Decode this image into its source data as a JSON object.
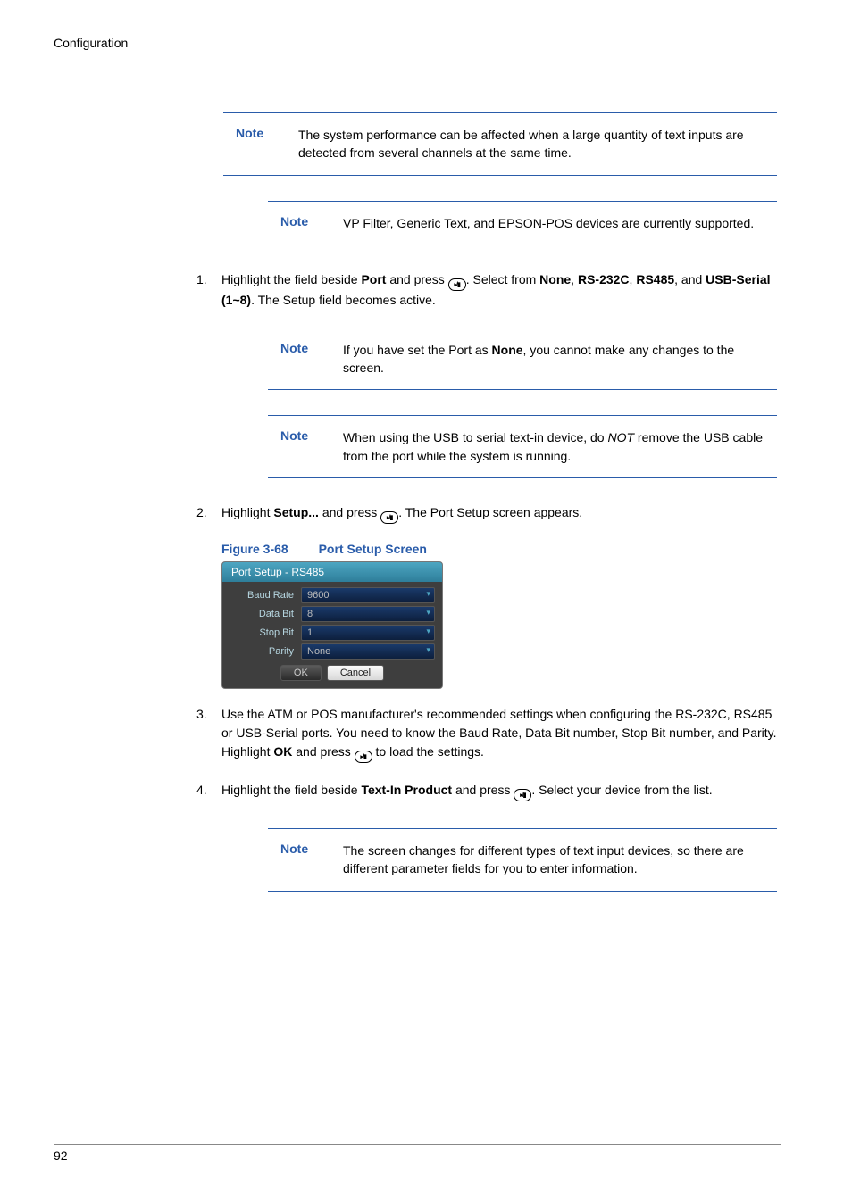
{
  "header": "Configuration",
  "note1": {
    "label": "Note",
    "text": "The system performance can be affected when a large quantity of text inputs are detected from several channels at the same time."
  },
  "note2": {
    "label": "Note",
    "text": "VP Filter, Generic Text, and EPSON-POS devices are currently supported."
  },
  "step1": {
    "num": "1.",
    "text_pre": "Highlight the field beside ",
    "bold1": "Port",
    "mid1": " and press ",
    "mid2": ". Select from ",
    "bold2": "None",
    "sep1": ", ",
    "bold3": "RS-232C",
    "sep2": ", ",
    "bold4": "RS485",
    "sep3": ", and ",
    "bold5": "USB-Serial (1~8)",
    "text_post": ". The Setup field becomes active."
  },
  "note3": {
    "label": "Note",
    "text_pre": "If you have set the Port as ",
    "bold": "None",
    "text_post": ", you cannot make any changes to the screen."
  },
  "note4": {
    "label": "Note",
    "text_pre": "When using the USB to serial text-in device, do ",
    "italic": "NOT",
    "text_post": " remove the USB cable from the port while the system is running."
  },
  "step2": {
    "num": "2.",
    "text_pre": "Highlight ",
    "bold1": "Setup...",
    "mid1": " and press ",
    "text_post": ". The Port Setup screen appears."
  },
  "figure": {
    "num": "Figure 3-68",
    "title": "Port Setup Screen"
  },
  "dialog": {
    "title": "Port Setup - RS485",
    "rows": [
      {
        "label": "Baud Rate",
        "value": "9600"
      },
      {
        "label": "Data Bit",
        "value": "8"
      },
      {
        "label": "Stop Bit",
        "value": "1"
      },
      {
        "label": "Parity",
        "value": "None"
      }
    ],
    "ok": "OK",
    "cancel": "Cancel"
  },
  "step3": {
    "num": "3.",
    "text_pre": "Use the ATM or POS manufacturer's recommended settings when configuring the RS-232C, RS485 or USB-Serial ports. You need to know the Baud Rate, Data Bit number, Stop Bit number, and Parity. Highlight ",
    "bold1": "OK",
    "mid1": " and press ",
    "text_post": " to load the settings."
  },
  "step4": {
    "num": "4.",
    "text_pre": "Highlight the field beside ",
    "bold1": "Text-In Product",
    "mid1": " and press ",
    "text_post": ". Select your device from the list."
  },
  "note5": {
    "label": "Note",
    "text": "The screen changes for different types of text input devices, so there are different parameter fields for you to enter information."
  },
  "pagenum": "92"
}
